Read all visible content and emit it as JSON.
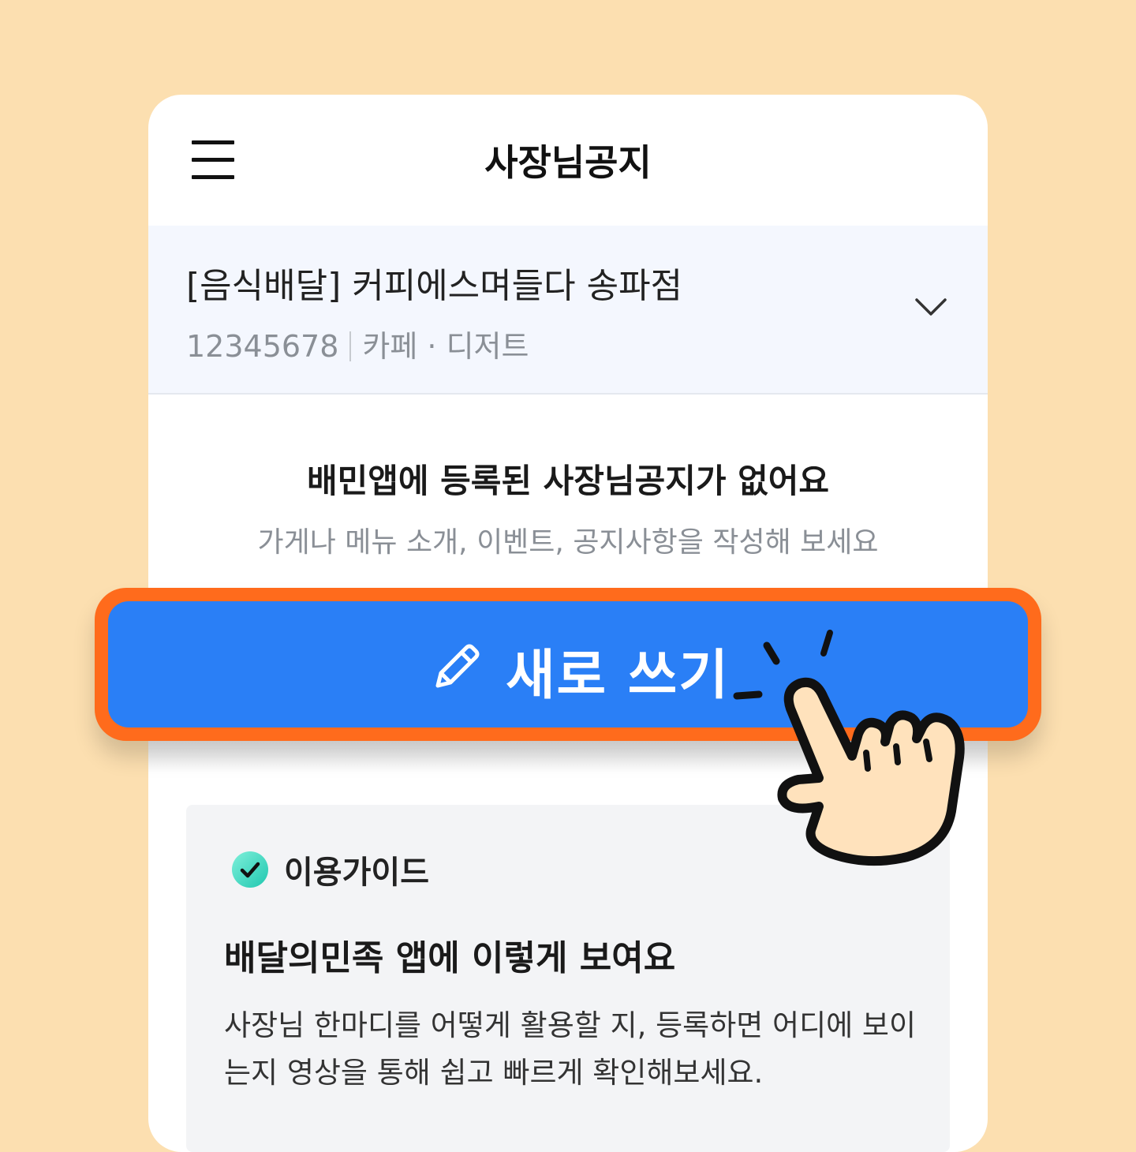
{
  "header": {
    "title": "사장님공지",
    "menu_icon": "hamburger-menu-icon"
  },
  "store": {
    "name": "[음식배달] 커피에스며들다 송파점",
    "id": "12345678",
    "category": "카페 · 디저트",
    "dropdown_icon": "chevron-down-icon"
  },
  "empty_state": {
    "title": "배민앱에 등록된 사장님공지가 없어요",
    "subtitle": "가게나 메뉴 소개, 이벤트, 공지사항을 작성해 보세요"
  },
  "cta": {
    "label": "새로 쓰기",
    "icon": "pencil-icon",
    "button_color": "#2A7FF6",
    "highlight_color": "#FF6B1C"
  },
  "guide": {
    "label": "이용가이드",
    "icon": "check-circle-icon",
    "title": "배달의민족 앱에 이렇게 보여요",
    "description": "사장님 한마디를 어떻게 활용할 지, 등록하면 어디에 보이는지 영상을 통해 쉽고 빠르게 확인해보세요."
  },
  "background_color": "#FCDFB0"
}
